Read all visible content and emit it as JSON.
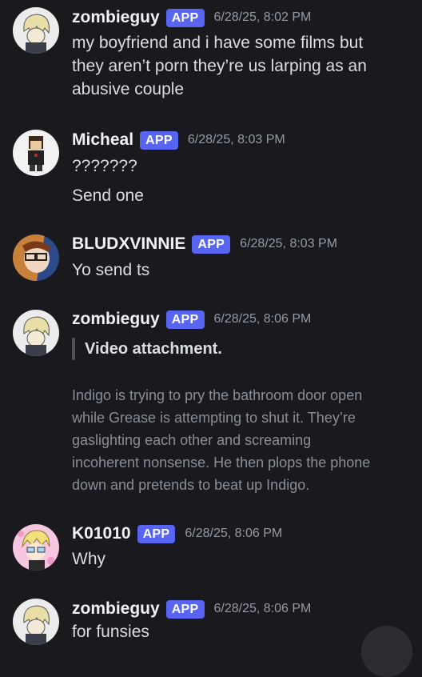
{
  "messages": [
    {
      "username": "zombieguy",
      "badge": "APP",
      "timestamp": "6/28/25, 8:02 PM",
      "lines": [
        "my  boyfriend and i have some films  but",
        "they aren’t porn they’re us larping as an",
        "abusive couple"
      ]
    },
    {
      "username": "Micheal",
      "badge": "APP",
      "timestamp": "6/28/25, 8:03 PM",
      "lines": [
        "???????",
        "Send one"
      ]
    },
    {
      "username": "BLUDXVINNIE",
      "badge": "APP",
      "timestamp": "6/28/25, 8:03 PM",
      "lines": [
        "Yo send ts"
      ]
    },
    {
      "username": "zombieguy",
      "badge": "APP",
      "timestamp": "6/28/25, 8:06 PM",
      "embed_title": "Video attachment.",
      "description": [
        "Indigo is trying to pry the bathroom door open",
        "while Grease is attempting to shut it. They’re",
        "gaslighting each other and screaming",
        "incoherent nonsense. He then plops the phone",
        "down and pretends to beat up Indigo."
      ]
    },
    {
      "username": "K01010",
      "badge": "APP",
      "timestamp": "6/28/25, 8:06 PM",
      "lines": [
        "Why"
      ]
    },
    {
      "username": "zombieguy",
      "badge": "APP",
      "timestamp": "6/28/25, 8:06 PM",
      "lines": [
        "for funsies"
      ]
    }
  ],
  "colors": {
    "background": "#1a1a1e",
    "badge": "#5865f2",
    "timestamp": "#949ba4"
  }
}
